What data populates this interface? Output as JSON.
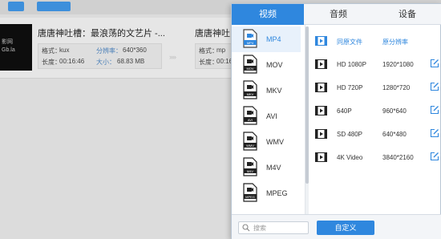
{
  "background": {
    "thumbnail_text": [
      "影网",
      "Gb.la"
    ],
    "files": [
      {
        "title": "唐唐神吐槽：最浪荡的文艺片 -...",
        "format_label": "格式：",
        "format_value": "kux",
        "resolution_label": "分辨率：",
        "resolution_value": "640*360",
        "duration_label": "长度：",
        "duration_value": "00:16:46",
        "size_label": "大小：",
        "size_value": "68.83 MB"
      },
      {
        "title": "唐唐神吐",
        "format_label": "格式：",
        "format_value": "mp",
        "duration_label": "长度：",
        "duration_value": "00:16:"
      }
    ],
    "arrow": "››››"
  },
  "popup": {
    "tabs": [
      {
        "label": "视频",
        "active": true
      },
      {
        "label": "音频",
        "active": false
      },
      {
        "label": "设备",
        "active": false
      }
    ],
    "formats": [
      {
        "label": "MP4",
        "badge": "MP4",
        "selected": true
      },
      {
        "label": "MOV",
        "badge": "MOV",
        "selected": false
      },
      {
        "label": "MKV",
        "badge": "MKV",
        "selected": false
      },
      {
        "label": "AVI",
        "badge": "AVI",
        "selected": false
      },
      {
        "label": "WMV",
        "badge": "WMV",
        "selected": false
      },
      {
        "label": "M4V",
        "badge": "M4V",
        "selected": false
      },
      {
        "label": "MPEG",
        "badge": "MPEG",
        "selected": false
      }
    ],
    "presets": [
      {
        "name": "同原文件",
        "resolution": "原分辨率"
      },
      {
        "name": "HD 1080P",
        "resolution": "1920*1080"
      },
      {
        "name": "HD 720P",
        "resolution": "1280*720"
      },
      {
        "name": "640P",
        "resolution": "960*640"
      },
      {
        "name": "SD 480P",
        "resolution": "640*480"
      },
      {
        "name": "4K Video",
        "resolution": "3840*2160"
      }
    ],
    "search_placeholder": "搜索",
    "custom_button": "自定义"
  },
  "colors": {
    "accent": "#2f87de",
    "selected_bg": "#e8f1fb"
  }
}
